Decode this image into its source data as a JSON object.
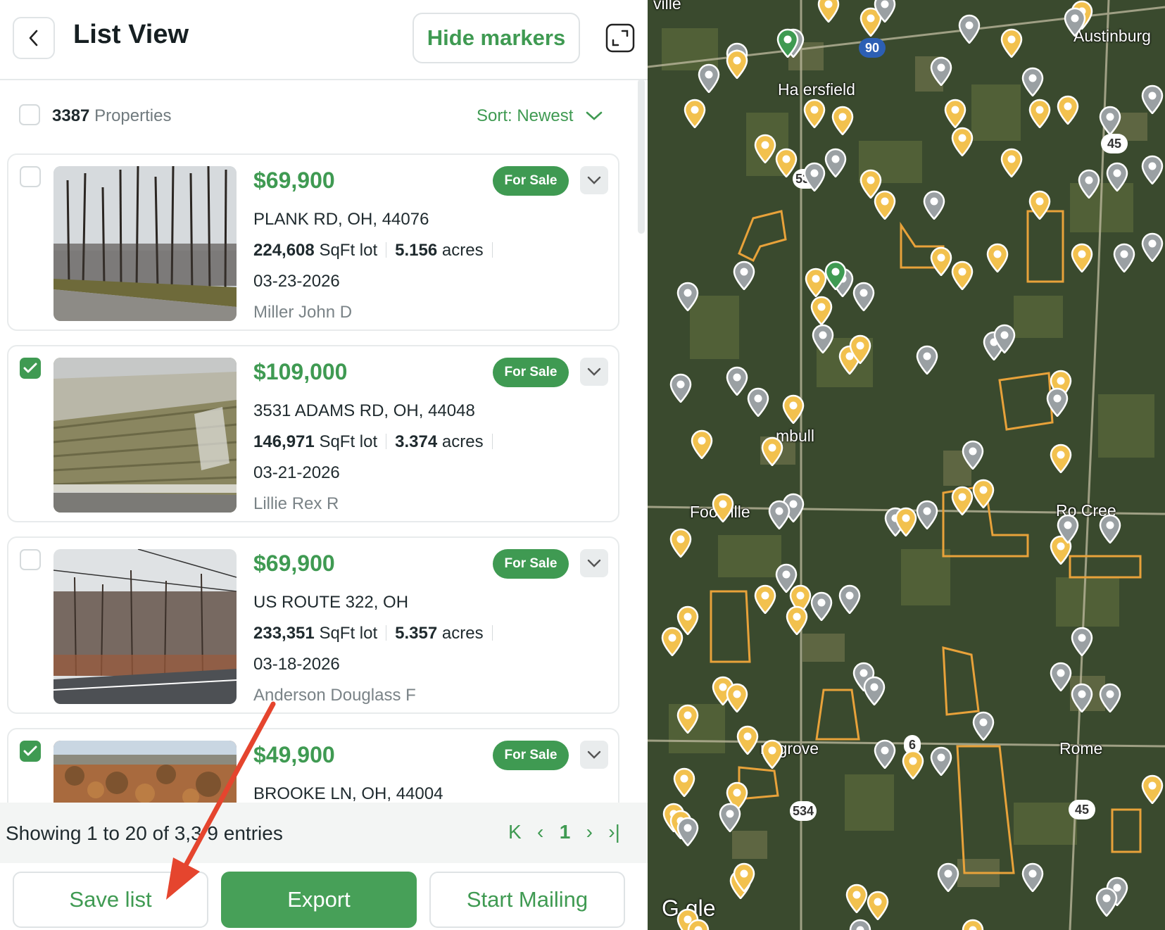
{
  "header": {
    "title": "List View",
    "hide_markers_label": "Hide markers"
  },
  "list_header": {
    "count": "3387",
    "count_label": "Properties",
    "sort_label": "Sort: Newest"
  },
  "listings": [
    {
      "price": "$69,900",
      "status": "For Sale",
      "address": "PLANK RD, OH, 44076",
      "sqft": "224,608",
      "sqft_unit": "SqFt lot",
      "acres": "5.156",
      "acres_unit": "acres",
      "date": "03-23-2026",
      "owner": "Miller John D",
      "checked": false
    },
    {
      "price": "$109,000",
      "status": "For Sale",
      "address": "3531 ADAMS RD, OH, 44048",
      "sqft": "146,971",
      "sqft_unit": "SqFt lot",
      "acres": "3.374",
      "acres_unit": "acres",
      "date": "03-21-2026",
      "owner": "Lillie Rex R",
      "checked": true
    },
    {
      "price": "$69,900",
      "status": "For Sale",
      "address": "US ROUTE 322, OH",
      "sqft": "233,351",
      "sqft_unit": "SqFt lot",
      "acres": "5.357",
      "acres_unit": "acres",
      "date": "03-18-2026",
      "owner": "Anderson Douglass F",
      "checked": false
    },
    {
      "price": "$49,900",
      "status": "For Sale",
      "address": "BROOKE LN, OH, 44004",
      "checked": true
    }
  ],
  "pagination": {
    "showing_text": "Showing 1 to 20 of 3,3  9 entries",
    "first": "K",
    "prev": "‹",
    "current": "1",
    "next": "›",
    "last": "›|"
  },
  "actions": {
    "save_list": "Save list",
    "export": "Export",
    "start_mailing": "Start Mailing"
  },
  "map": {
    "labels": [
      "ville",
      "Austinburg",
      "Ha  ersfield",
      "  mbull",
      "Footville",
      "Ro  Cree",
      "  rtsgrove",
      "Rome",
      "G  gle"
    ],
    "shields": [
      "90",
      "534",
      "45",
      "534",
      "45",
      "6"
    ]
  },
  "colors": {
    "accent": "#3f9a52",
    "pin_yellow": "#f2c14e",
    "pin_grey": "#9aa0a3",
    "pin_green": "#3f9a52",
    "parcel_outline": "#e8a23a"
  }
}
